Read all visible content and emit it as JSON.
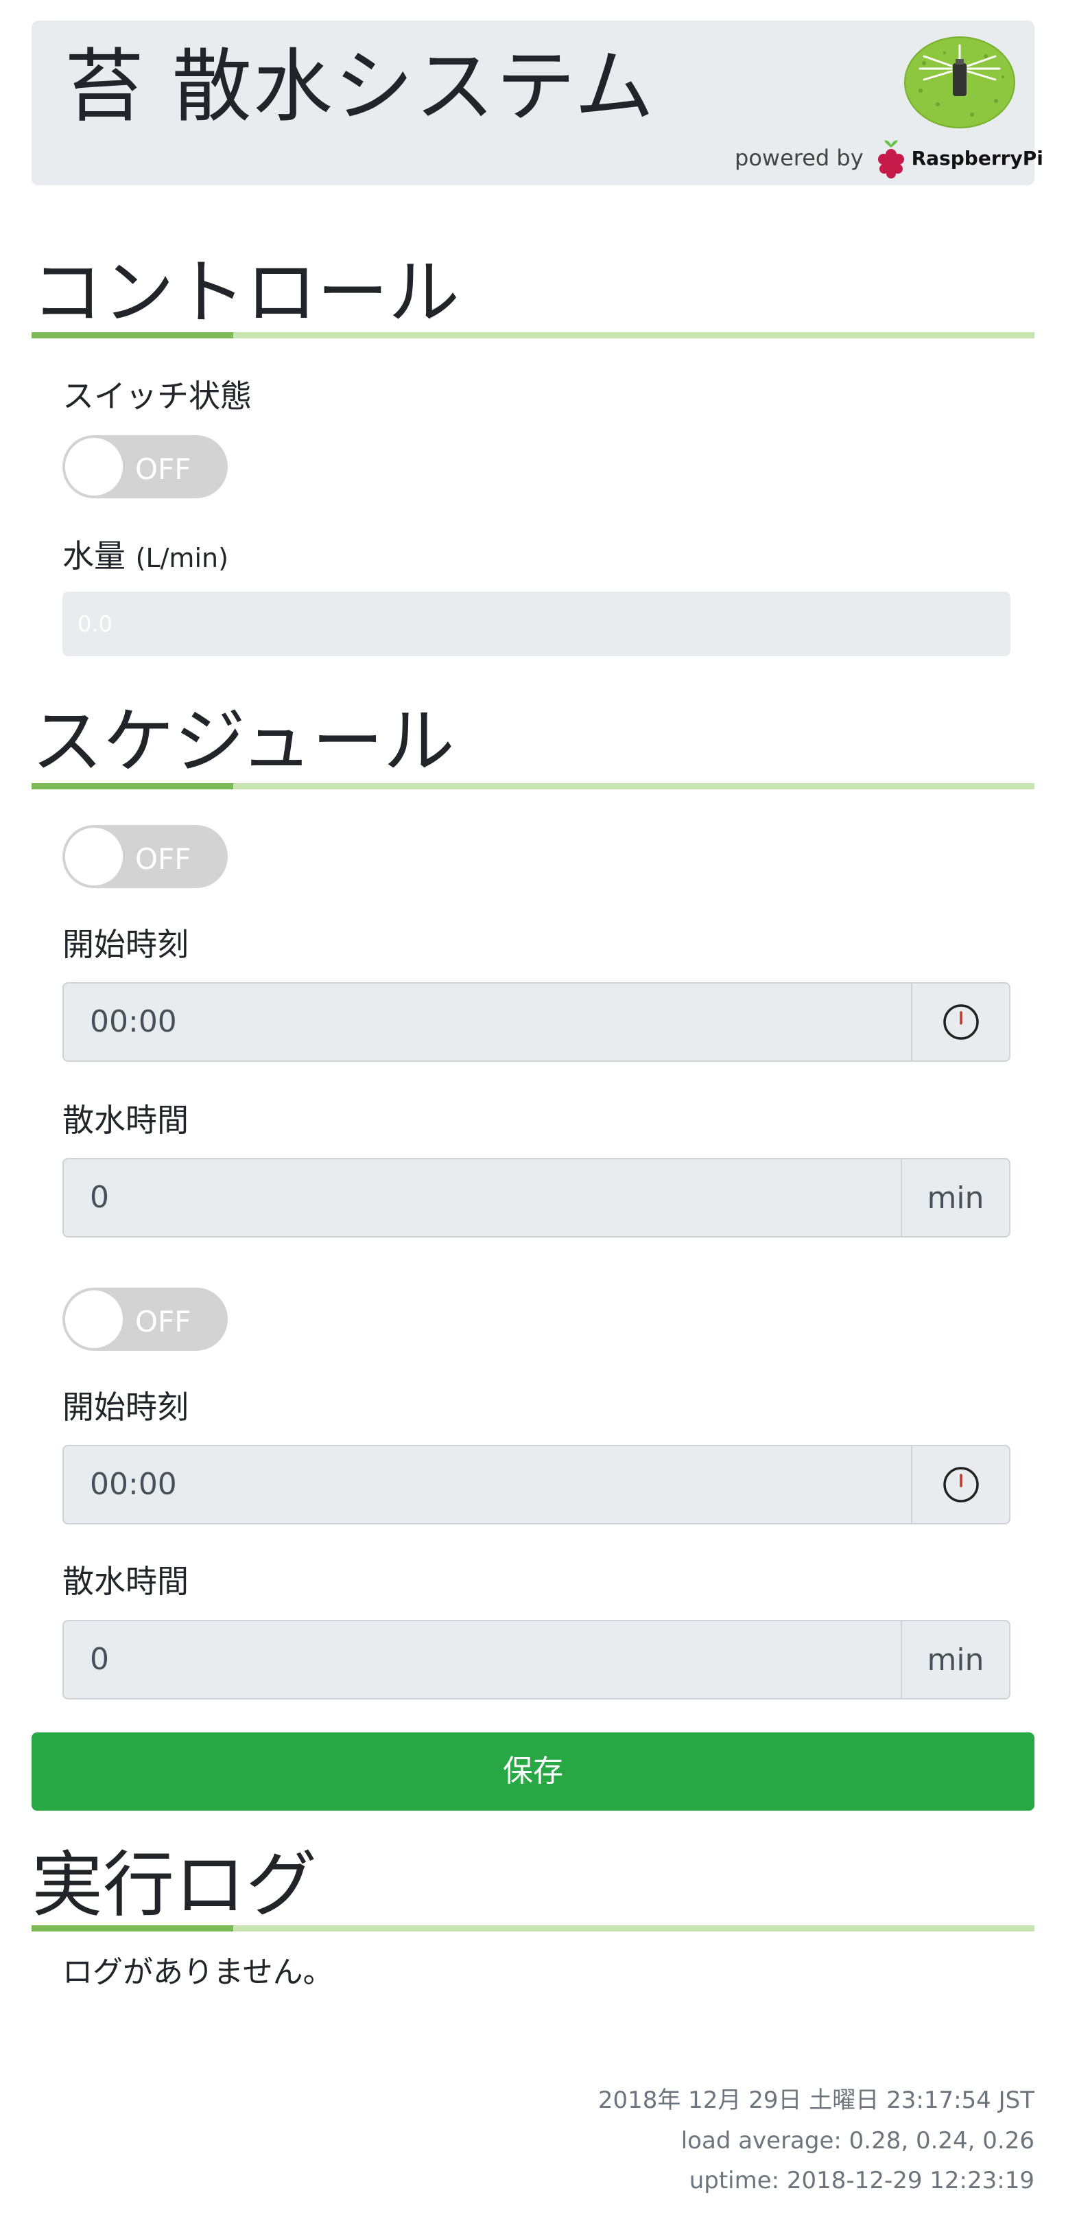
{
  "header": {
    "title": "苔 散水システム",
    "powered_by": "powered by",
    "brand": "RaspberryPi"
  },
  "control": {
    "heading": "コントロール",
    "switch_label": "スイッチ状態",
    "switch_state": "OFF",
    "flow_label": "水量",
    "flow_unit": "(L/min)",
    "flow_value": "0.0"
  },
  "schedule": {
    "heading": "スケジュール",
    "items": [
      {
        "toggle_state": "OFF",
        "start_label": "開始時刻",
        "start_value": "00:00",
        "duration_label": "散水時間",
        "duration_value": "0",
        "duration_unit": "min"
      },
      {
        "toggle_state": "OFF",
        "start_label": "開始時刻",
        "start_value": "00:00",
        "duration_label": "散水時間",
        "duration_value": "0",
        "duration_unit": "min"
      }
    ],
    "save_label": "保存"
  },
  "log": {
    "heading": "実行ログ",
    "empty_message": "ログがありません。"
  },
  "footer": {
    "datetime": "2018年 12月 29日 土曜日 23:17:54 JST",
    "load_average": "load average: 0.28, 0.24, 0.26",
    "uptime": "uptime: 2018-12-29 12:23:19"
  },
  "colors": {
    "header_bg": "#e9ecef",
    "accent_green": "#7cb957",
    "rule_light_green": "#c8e4b0",
    "save_button": "#28a745",
    "toggle_off": "#d3d3d3"
  }
}
